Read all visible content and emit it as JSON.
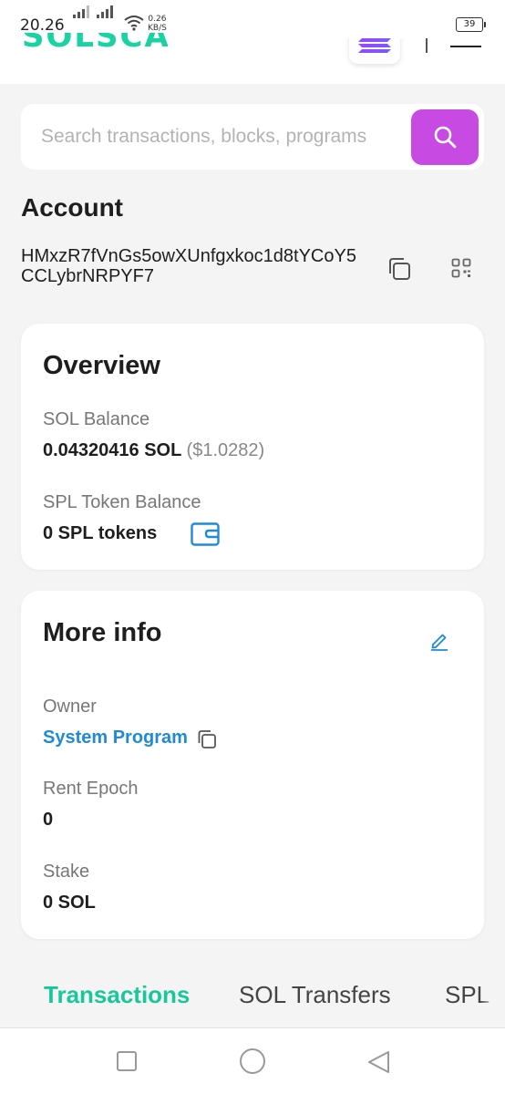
{
  "status_bar": {
    "time": "20.26",
    "net_speed_value": "0.26",
    "net_speed_unit": "KB/S",
    "battery": "39"
  },
  "header": {
    "logo_text": "SOLSCAN"
  },
  "search": {
    "placeholder": "Search transactions, blocks, programs and tokens"
  },
  "account": {
    "title": "Account",
    "address": "HMxzR7fVnGs5owXUnfgxkoc1d8tYCoY5CCLybrNRPYF7"
  },
  "overview": {
    "title": "Overview",
    "sol_balance_label": "SOL Balance",
    "sol_balance_value": "0.04320416 SOL",
    "sol_balance_usd": "($1.0282)",
    "spl_label": "SPL Token Balance",
    "spl_value": "0 SPL tokens"
  },
  "more_info": {
    "title": "More info",
    "owner_label": "Owner",
    "owner_value": "System Program",
    "rent_epoch_label": "Rent Epoch",
    "rent_epoch_value": "0",
    "stake_label": "Stake",
    "stake_value": "0 SOL"
  },
  "tabs": [
    {
      "label": "Transactions",
      "active": true
    },
    {
      "label": "SOL Transfers",
      "active": false
    },
    {
      "label": "SPL",
      "active": false
    }
  ],
  "colors": {
    "brand_green": "#19d3a2",
    "search_button": "#c74ae3",
    "link_blue": "#1f8bd6"
  },
  "icons": [
    "search-icon",
    "copy-icon",
    "qr-code-icon",
    "wallet-icon",
    "edit-icon",
    "solana-icon",
    "menu-icon"
  ]
}
